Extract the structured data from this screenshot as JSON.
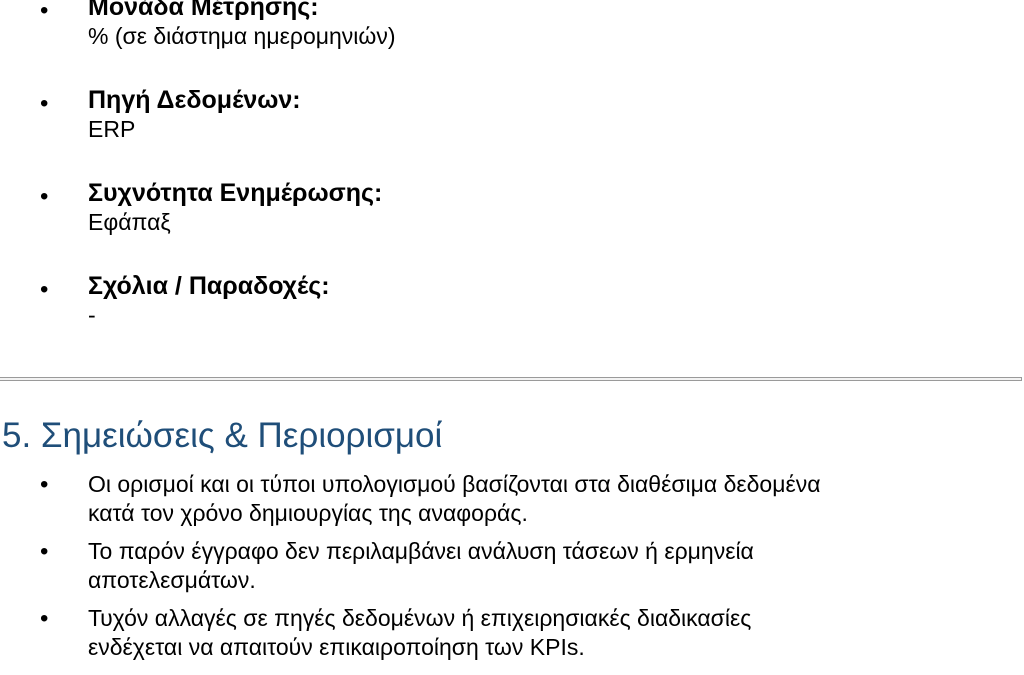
{
  "definitions": [
    {
      "term": "Μονάδα Μέτρησης:",
      "value": "% (σε διάστημα ημερομηνιών)"
    },
    {
      "term": "Πηγή Δεδομένων:",
      "value": "ERP"
    },
    {
      "term": "Συχνότητα Ενημέρωσης:",
      "value": "Εφάπαξ"
    },
    {
      "term": "Σχόλια / Παραδοχές:",
      "value": "-"
    }
  ],
  "section": {
    "title": "5. Σημειώσεις & Περιορισμοί",
    "notes": [
      {
        "line1": "Οι ορισμοί και οι τύποι υπολογισμού βασίζονται στα διαθέσιμα δεδομένα",
        "line2": "κατά τον χρόνο δημιουργίας της αναφοράς."
      },
      {
        "line1": "Το παρόν έγγραφο δεν περιλαμβάνει ανάλυση τάσεων ή ερμηνεία",
        "line2": "αποτελεσμάτων."
      },
      {
        "line1": "Τυχόν αλλαγές σε πηγές δεδομένων ή επιχειρησιακές διαδικασίες",
        "line2": "ενδέχεται να απαιτούν επικαιροποίηση των KPIs."
      }
    ]
  },
  "colors": {
    "heading": "#1f4e79",
    "text": "#000000",
    "separator": "#9a9a9a"
  }
}
